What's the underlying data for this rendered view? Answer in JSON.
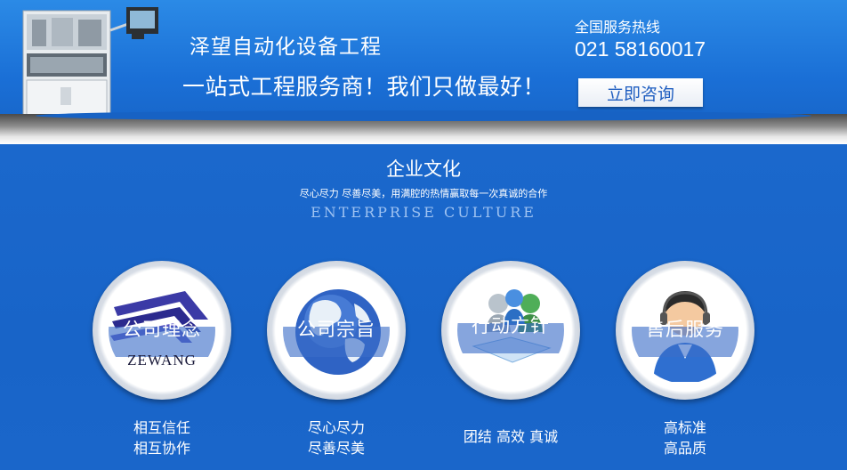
{
  "banner": {
    "company": "泽望自动化设备工程",
    "tagline": "一站式工程服务商！我们只做最好！",
    "hotline_label": "全国服务热线",
    "hotline_number": "021 58160017",
    "consult_button": "立即咨询"
  },
  "section": {
    "title": "企业文化",
    "subtitle": "尽心尽力 尽善尽美，用满腔的热情赢取每一次真诚的合作",
    "title_en": "ENTERPRISE CULTURE"
  },
  "items": [
    {
      "label": "公司理念",
      "icon": "zewang-logo-icon",
      "logo_text": "ZEWANG",
      "desc": [
        "相互信任",
        "相互协作"
      ]
    },
    {
      "label": "公司宗旨",
      "icon": "globe-icon",
      "desc": [
        "尽心尽力",
        "尽善尽美"
      ]
    },
    {
      "label": "行动方针",
      "icon": "team-people-icon",
      "desc": [
        "团结 高效 真诚"
      ]
    },
    {
      "label": "售后服务",
      "icon": "customer-service-icon",
      "desc": [
        "高标准",
        "高品质"
      ]
    }
  ],
  "colors": {
    "banner_blue": "#1a6fd6",
    "section_blue": "#1864c8",
    "button_text": "#1f5ec0"
  }
}
